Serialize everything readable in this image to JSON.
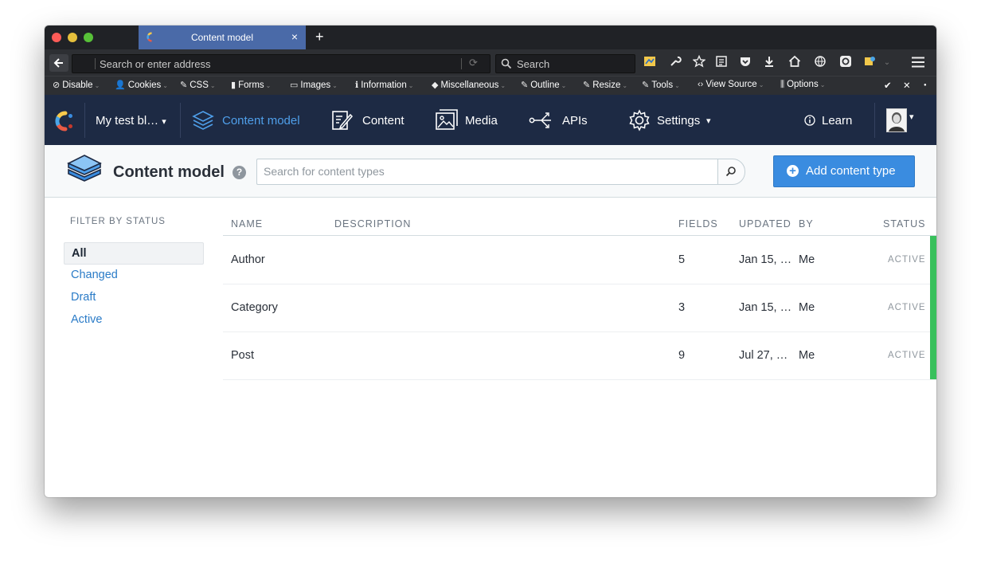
{
  "browser": {
    "tab_title": "Content model",
    "tab_close": "×",
    "new_tab": "+",
    "back": "🡐",
    "url_placeholder": "Search or enter address",
    "search_placeholder": "Search",
    "reload": "⟳"
  },
  "devtoolbar": [
    {
      "label": "Disable",
      "glyph": "⊘"
    },
    {
      "label": "Cookies",
      "glyph": "👤"
    },
    {
      "label": "CSS",
      "glyph": "✎"
    },
    {
      "label": "Forms",
      "glyph": "▮"
    },
    {
      "label": "Images",
      "glyph": "▭"
    },
    {
      "label": "Information",
      "glyph": "ℹ"
    },
    {
      "label": "Miscellaneous",
      "glyph": "◆"
    },
    {
      "label": "Outline",
      "glyph": "✎"
    },
    {
      "label": "Resize",
      "glyph": "✎"
    },
    {
      "label": "Tools",
      "glyph": "✎"
    },
    {
      "label": "View Source",
      "glyph": "‹›"
    },
    {
      "label": "Options",
      "glyph": "⫼"
    }
  ],
  "devtoolbar_right": {
    "check": "✔",
    "close": "✕",
    "dot": "●"
  },
  "app": {
    "space_name": "My test bl…",
    "nav": {
      "content_model": "Content model",
      "content": "Content",
      "media": "Media",
      "apis": "APIs",
      "settings": "Settings",
      "learn": "Learn"
    }
  },
  "page": {
    "title": "Content model",
    "help": "?",
    "search_placeholder": "Search for content types",
    "add_button": "Add content type"
  },
  "sidebar": {
    "title": "FILTER BY STATUS",
    "items": [
      "All",
      "Changed",
      "Draft",
      "Active"
    ]
  },
  "table": {
    "headers": {
      "name": "NAME",
      "description": "DESCRIPTION",
      "fields": "FIELDS",
      "updated": "UPDATED",
      "by": "BY",
      "status": "STATUS"
    },
    "rows": [
      {
        "name": "Author",
        "description": "",
        "fields": "5",
        "updated": "Jan 15, …",
        "by": "Me",
        "status": "ACTIVE"
      },
      {
        "name": "Category",
        "description": "",
        "fields": "3",
        "updated": "Jan 15, …",
        "by": "Me",
        "status": "ACTIVE"
      },
      {
        "name": "Post",
        "description": "",
        "fields": "9",
        "updated": "Jul 27, …",
        "by": "Me",
        "status": "ACTIVE"
      }
    ]
  },
  "colors": {
    "app_header": "#1d2a44",
    "active_nav": "#4f9fea",
    "primary_button": "#3a8ce0",
    "status_active": "#38c05b"
  }
}
